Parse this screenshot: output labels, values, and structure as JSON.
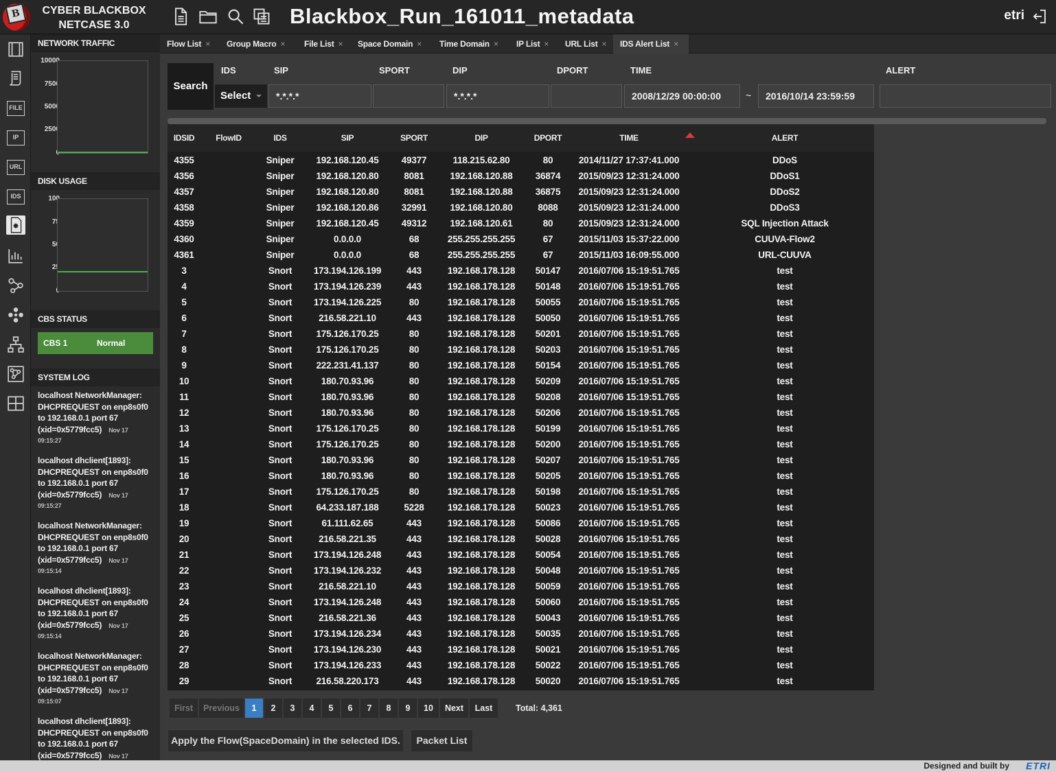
{
  "brand": {
    "line1": "CYBER BLACKBOX",
    "line2": "NETCASE 3.0",
    "logo_letter": "B"
  },
  "toolbar_icons": [
    "document-icon",
    "folder-icon",
    "search-icon",
    "copy-icon"
  ],
  "title": "Blackbox_Run_161011_metadata",
  "user": "etri",
  "rail": {
    "text_items": [
      "FILE",
      "IP",
      "URL",
      "IDS"
    ]
  },
  "network_traffic": {
    "title": "NETWORK TRAFFIC",
    "yticks": [
      "10000",
      "7500",
      "5000",
      "2500",
      "0"
    ],
    "line_color": "#4caf50",
    "value_fraction": 0.0
  },
  "disk_usage": {
    "title": "DISK USAGE",
    "yticks": [
      "100",
      "75",
      "50",
      "25",
      "0"
    ],
    "line_color": "#4caf50",
    "value": 20
  },
  "cbs_status": {
    "title": "CBS STATUS",
    "name": "CBS 1",
    "status": "Normal",
    "color": "#4a8c3c"
  },
  "system_log": {
    "title": "SYSTEM LOG",
    "entries": [
      {
        "lines": [
          "localhost NetworkManager:",
          "DHCPREQUEST on enp8s0f0",
          "to 192.168.0.1 port 67",
          "(xid=0x5779fcc5)"
        ],
        "date": "Nov 17",
        "time": "09:15:27"
      },
      {
        "lines": [
          "localhost dhclient[1893]:",
          "DHCPREQUEST on enp8s0f0",
          "to 192.168.0.1 port 67",
          "(xid=0x5779fcc5)"
        ],
        "date": "Nov 17",
        "time": "09:15:27"
      },
      {
        "lines": [
          "localhost NetworkManager:",
          "DHCPREQUEST on enp8s0f0",
          "to 192.168.0.1 port 67",
          "(xid=0x5779fcc5)"
        ],
        "date": "Nov 17",
        "time": "09:15:14"
      },
      {
        "lines": [
          "localhost dhclient[1893]:",
          "DHCPREQUEST on enp8s0f0",
          "to 192.168.0.1 port 67",
          "(xid=0x5779fcc5)"
        ],
        "date": "Nov 17",
        "time": "09:15:14"
      },
      {
        "lines": [
          "localhost NetworkManager:",
          "DHCPREQUEST on enp8s0f0",
          "to 192.168.0.1 port 67",
          "(xid=0x5779fcc5)"
        ],
        "date": "Nov 17",
        "time": "09:15:07"
      },
      {
        "lines": [
          "localhost dhclient[1893]:",
          "DHCPREQUEST on enp8s0f0",
          "to 192.168.0.1 port 67",
          "(xid=0x5779fcc5)"
        ],
        "date": "Nov 17",
        "time": ""
      }
    ]
  },
  "tabs": [
    {
      "label": "Flow List",
      "active": false
    },
    {
      "label": "Group Macro",
      "active": false
    },
    {
      "label": "File List",
      "active": false
    },
    {
      "label": "Space Domain",
      "active": false
    },
    {
      "label": "Time Domain",
      "active": false
    },
    {
      "label": "IP List",
      "active": false
    },
    {
      "label": "URL List",
      "active": false
    },
    {
      "label": "IDS Alert List",
      "active": true
    }
  ],
  "tab_close": "×",
  "filter": {
    "search_label": "Search",
    "labels": {
      "ids": "IDS",
      "sip": "SIP",
      "sport": "SPORT",
      "dip": "DIP",
      "dport": "DPORT",
      "time": "TIME",
      "alert": "ALERT"
    },
    "ids_value": "Select",
    "sip_value": "*.*.*.*",
    "sport_value": "",
    "dip_value": "*.*.*.*",
    "dport_value": "",
    "time_from": "2008/12/29 00:00:00",
    "time_sep": "~",
    "time_to": "2016/10/14 23:59:59",
    "alert_value": ""
  },
  "table": {
    "columns": [
      "IDSID",
      "FlowID",
      "IDS",
      "SIP",
      "SPORT",
      "DIP",
      "DPORT",
      "TIME",
      "ALERT"
    ],
    "sort_column": "TIME",
    "sort_direction": "asc",
    "rows": [
      [
        "4355",
        "",
        "Sniper",
        "192.168.120.45",
        "49377",
        "118.215.62.80",
        "80",
        "2014/11/27 17:37:41.000",
        "DDoS"
      ],
      [
        "4356",
        "",
        "Sniper",
        "192.168.120.80",
        "8081",
        "192.168.120.88",
        "36874",
        "2015/09/23 12:31:24.000",
        "DDoS1"
      ],
      [
        "4357",
        "",
        "Sniper",
        "192.168.120.80",
        "8081",
        "192.168.120.88",
        "36875",
        "2015/09/23 12:31:24.000",
        "DDoS2"
      ],
      [
        "4358",
        "",
        "Sniper",
        "192.168.120.86",
        "32991",
        "192.168.120.80",
        "8088",
        "2015/09/23 12:31:24.000",
        "DDoS3"
      ],
      [
        "4359",
        "",
        "Sniper",
        "192.168.120.45",
        "49312",
        "192.168.120.61",
        "80",
        "2015/09/23 12:31:24.000",
        "SQL Injection Attack"
      ],
      [
        "4360",
        "",
        "Sniper",
        "0.0.0.0",
        "68",
        "255.255.255.255",
        "67",
        "2015/11/03 15:37:22.000",
        "CUUVA-Flow2"
      ],
      [
        "4361",
        "",
        "Sniper",
        "0.0.0.0",
        "68",
        "255.255.255.255",
        "67",
        "2015/11/03 16:09:55.000",
        "URL-CUUVA"
      ],
      [
        "3",
        "",
        "Snort",
        "173.194.126.199",
        "443",
        "192.168.178.128",
        "50147",
        "2016/07/06 15:19:51.765",
        "test"
      ],
      [
        "4",
        "",
        "Snort",
        "173.194.126.239",
        "443",
        "192.168.178.128",
        "50148",
        "2016/07/06 15:19:51.765",
        "test"
      ],
      [
        "5",
        "",
        "Snort",
        "173.194.126.225",
        "80",
        "192.168.178.128",
        "50055",
        "2016/07/06 15:19:51.765",
        "test"
      ],
      [
        "6",
        "",
        "Snort",
        "216.58.221.10",
        "443",
        "192.168.178.128",
        "50050",
        "2016/07/06 15:19:51.765",
        "test"
      ],
      [
        "7",
        "",
        "Snort",
        "175.126.170.25",
        "80",
        "192.168.178.128",
        "50201",
        "2016/07/06 15:19:51.765",
        "test"
      ],
      [
        "8",
        "",
        "Snort",
        "175.126.170.25",
        "80",
        "192.168.178.128",
        "50203",
        "2016/07/06 15:19:51.765",
        "test"
      ],
      [
        "9",
        "",
        "Snort",
        "222.231.41.137",
        "80",
        "192.168.178.128",
        "50154",
        "2016/07/06 15:19:51.765",
        "test"
      ],
      [
        "10",
        "",
        "Snort",
        "180.70.93.96",
        "80",
        "192.168.178.128",
        "50209",
        "2016/07/06 15:19:51.765",
        "test"
      ],
      [
        "11",
        "",
        "Snort",
        "180.70.93.96",
        "80",
        "192.168.178.128",
        "50208",
        "2016/07/06 15:19:51.765",
        "test"
      ],
      [
        "12",
        "",
        "Snort",
        "180.70.93.96",
        "80",
        "192.168.178.128",
        "50206",
        "2016/07/06 15:19:51.765",
        "test"
      ],
      [
        "13",
        "",
        "Snort",
        "175.126.170.25",
        "80",
        "192.168.178.128",
        "50199",
        "2016/07/06 15:19:51.765",
        "test"
      ],
      [
        "14",
        "",
        "Snort",
        "175.126.170.25",
        "80",
        "192.168.178.128",
        "50200",
        "2016/07/06 15:19:51.765",
        "test"
      ],
      [
        "15",
        "",
        "Snort",
        "180.70.93.96",
        "80",
        "192.168.178.128",
        "50207",
        "2016/07/06 15:19:51.765",
        "test"
      ],
      [
        "16",
        "",
        "Snort",
        "180.70.93.96",
        "80",
        "192.168.178.128",
        "50205",
        "2016/07/06 15:19:51.765",
        "test"
      ],
      [
        "17",
        "",
        "Snort",
        "175.126.170.25",
        "80",
        "192.168.178.128",
        "50198",
        "2016/07/06 15:19:51.765",
        "test"
      ],
      [
        "18",
        "",
        "Snort",
        "64.233.187.188",
        "5228",
        "192.168.178.128",
        "50023",
        "2016/07/06 15:19:51.765",
        "test"
      ],
      [
        "19",
        "",
        "Snort",
        "61.111.62.65",
        "443",
        "192.168.178.128",
        "50086",
        "2016/07/06 15:19:51.765",
        "test"
      ],
      [
        "20",
        "",
        "Snort",
        "216.58.221.35",
        "443",
        "192.168.178.128",
        "50028",
        "2016/07/06 15:19:51.765",
        "test"
      ],
      [
        "21",
        "",
        "Snort",
        "173.194.126.248",
        "443",
        "192.168.178.128",
        "50054",
        "2016/07/06 15:19:51.765",
        "test"
      ],
      [
        "22",
        "",
        "Snort",
        "173.194.126.232",
        "443",
        "192.168.178.128",
        "50048",
        "2016/07/06 15:19:51.765",
        "test"
      ],
      [
        "23",
        "",
        "Snort",
        "216.58.221.10",
        "443",
        "192.168.178.128",
        "50059",
        "2016/07/06 15:19:51.765",
        "test"
      ],
      [
        "24",
        "",
        "Snort",
        "173.194.126.248",
        "443",
        "192.168.178.128",
        "50060",
        "2016/07/06 15:19:51.765",
        "test"
      ],
      [
        "25",
        "",
        "Snort",
        "216.58.221.36",
        "443",
        "192.168.178.128",
        "50043",
        "2016/07/06 15:19:51.765",
        "test"
      ],
      [
        "26",
        "",
        "Snort",
        "173.194.126.234",
        "443",
        "192.168.178.128",
        "50035",
        "2016/07/06 15:19:51.765",
        "test"
      ],
      [
        "27",
        "",
        "Snort",
        "173.194.126.230",
        "443",
        "192.168.178.128",
        "50021",
        "2016/07/06 15:19:51.765",
        "test"
      ],
      [
        "28",
        "",
        "Snort",
        "173.194.126.233",
        "443",
        "192.168.178.128",
        "50022",
        "2016/07/06 15:19:51.765",
        "test"
      ],
      [
        "29",
        "",
        "Snort",
        "216.58.220.173",
        "443",
        "192.168.178.128",
        "50020",
        "2016/07/06 15:19:51.765",
        "test"
      ]
    ]
  },
  "pagination": {
    "first": "First",
    "previous": "Previous",
    "pages": [
      "1",
      "2",
      "3",
      "4",
      "5",
      "6",
      "7",
      "8",
      "9",
      "10"
    ],
    "current": "1",
    "next": "Next",
    "last": "Last",
    "total": "Total: 4,361"
  },
  "actions": {
    "apply_label": "Apply the Flow(SpaceDomain) in the selected IDS.",
    "packet_label": "Packet List"
  },
  "footer": {
    "credit": "Designed and built by",
    "brand": "ETRI"
  },
  "accent_color": "#3a7fc4"
}
